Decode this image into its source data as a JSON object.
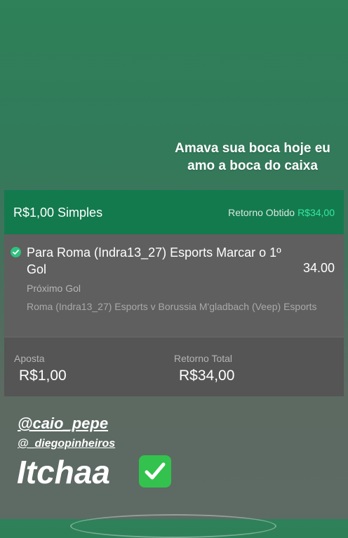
{
  "story": {
    "caption": "Amava sua boca hoje eu amo a boca do caixa",
    "mention_1": "@caio_pepe",
    "mention_2": "@_diegopinheiros",
    "big_text": "Itchaa"
  },
  "bet": {
    "type_label": "R$1,00 Simples",
    "return_label": "Retorno Obtido",
    "return_value": "R$34,00",
    "selection": "Para Roma (Indra13_27) Esports Marcar o 1º Gol",
    "odds": "34.00",
    "market": "Próximo Gol",
    "event": "Roma (Indra13_27) Esports v Borussia M'gladbach (Veep) Esports",
    "stake_label": "Aposta",
    "stake_value": "R$1,00",
    "total_return_label": "Retorno Total",
    "total_return_value": "R$34,00"
  },
  "colors": {
    "header_bg": "#137a4e",
    "return_accent": "#35e8a0",
    "check_green": "#2ec27e",
    "emoji_green": "#33c24d"
  },
  "icons": [
    "check-circle-icon",
    "check-mark-emoji-icon"
  ]
}
